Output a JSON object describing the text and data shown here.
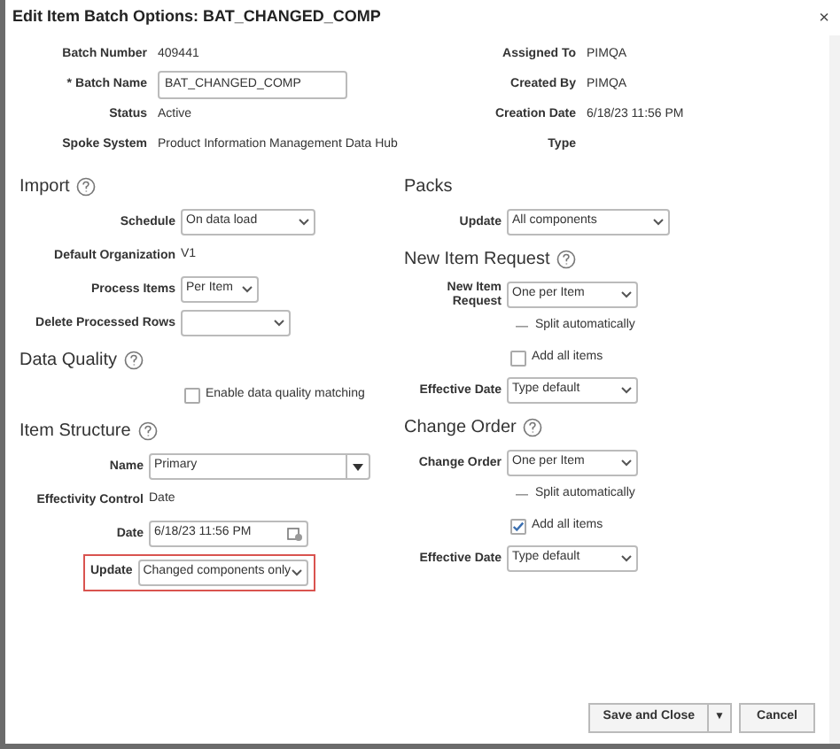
{
  "dialog": {
    "title": "Edit Item Batch Options: BAT_CHANGED_COMP",
    "close": "×"
  },
  "header_left": [
    {
      "kind": "text",
      "label": "Batch Number",
      "value": "409441"
    },
    {
      "kind": "input",
      "label": "Batch Name",
      "value": "BAT_CHANGED_COMP",
      "required": "*"
    },
    {
      "kind": "text",
      "label": "Status",
      "value": "Active"
    },
    {
      "kind": "text",
      "label": "Spoke System",
      "value": "Product Information Management Data Hub"
    }
  ],
  "header_right": [
    {
      "kind": "text",
      "label": "Assigned To",
      "value": "PIMQA"
    },
    {
      "kind": "text",
      "label": "Created By",
      "value": "PIMQA"
    },
    {
      "kind": "text",
      "label": "Creation Date",
      "value": "6/18/23 11:56 PM"
    },
    {
      "kind": "text",
      "label": "Type"
    }
  ],
  "left_sections": [
    {
      "title": "Import",
      "help": true,
      "rows": [
        {
          "kind": "select",
          "label": "Schedule",
          "value": "On data load"
        },
        {
          "kind": "text",
          "label": "Default Organization",
          "value": "V1"
        },
        {
          "kind": "select",
          "label": "Process Items",
          "value": "Per Item"
        },
        {
          "kind": "select",
          "label": "Delete Processed Rows"
        }
      ]
    },
    {
      "title": "Data Quality",
      "help": true,
      "rows": [
        {
          "kind": "checkbox",
          "label": "Enable data quality matching",
          "checked": false
        }
      ]
    },
    {
      "title": "Item Structure",
      "help": true,
      "rows": [
        {
          "kind": "combo",
          "label": "Name",
          "value": "Primary"
        },
        {
          "kind": "text",
          "label": "Effectivity Control",
          "value": "Date"
        },
        {
          "kind": "date",
          "label": "Date",
          "value": "6/18/23 11:56 PM"
        },
        {
          "kind": "select",
          "label": "Update",
          "value": "Changed components only",
          "highlighted": true
        }
      ]
    }
  ],
  "right_sections": [
    {
      "title": "Packs",
      "help": false,
      "rows": [
        {
          "kind": "select",
          "label": "Update",
          "value": "All components"
        }
      ]
    },
    {
      "title": "New Item Request",
      "help": true,
      "rows": [
        {
          "kind": "select",
          "label": "New Item Request",
          "value": "One per Item"
        },
        {
          "kind": "split",
          "label": "Split automatically"
        },
        {
          "kind": "checkbox",
          "label": "Add all items",
          "checked": false
        },
        {
          "kind": "select",
          "label": "Effective Date",
          "value": "Type default"
        }
      ]
    },
    {
      "title": "Change Order",
      "help": true,
      "rows": [
        {
          "kind": "select",
          "label": "Change Order",
          "value": "One per Item"
        },
        {
          "kind": "split",
          "label": "Split automatically"
        },
        {
          "kind": "checkbox",
          "label": "Add all items",
          "checked": true
        },
        {
          "kind": "select",
          "label": "Effective Date",
          "value": "Type default"
        }
      ]
    }
  ],
  "buttons": [
    {
      "kind": "split",
      "label": "Save and Close",
      "arrow": "▼"
    },
    {
      "kind": "plain",
      "label": "Cancel"
    }
  ]
}
